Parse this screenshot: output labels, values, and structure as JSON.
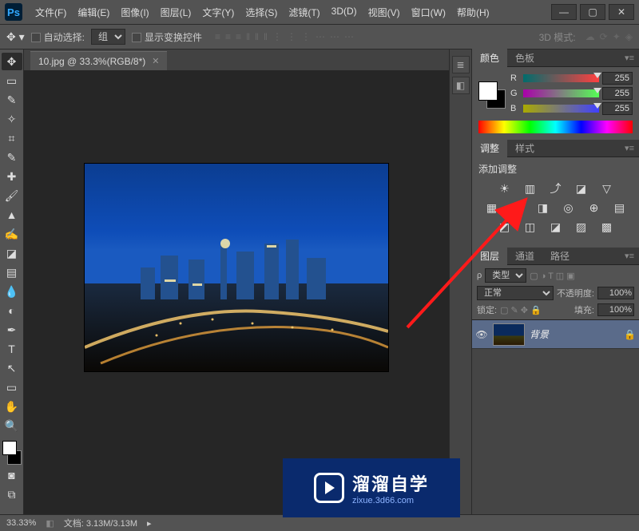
{
  "app": {
    "logo": "Ps"
  },
  "menu": [
    "文件(F)",
    "编辑(E)",
    "图像(I)",
    "图层(L)",
    "文字(Y)",
    "选择(S)",
    "滤镜(T)",
    "3D(D)",
    "视图(V)",
    "窗口(W)",
    "帮助(H)"
  ],
  "options": {
    "auto_select": "自动选择:",
    "group": "组",
    "show_transform": "显示变换控件",
    "mode3d": "3D 模式:"
  },
  "doc": {
    "tab_title": "10.jpg @ 33.3%(RGB/8*)"
  },
  "panels": {
    "color_tabs": [
      "颜色",
      "色板"
    ],
    "adjust_tabs": [
      "调整",
      "样式"
    ],
    "layer_tabs": [
      "图层",
      "通道",
      "路径"
    ]
  },
  "color": {
    "r_label": "R",
    "g_label": "G",
    "b_label": "B",
    "r": "255",
    "g": "255",
    "b": "255"
  },
  "adjust": {
    "title": "添加调整"
  },
  "layers": {
    "kind_label": "类型",
    "blend": "正常",
    "opacity_label": "不透明度:",
    "opacity": "100%",
    "lock_label": "锁定:",
    "fill_label": "填充:",
    "fill": "100%",
    "layer_name": "背景"
  },
  "status": {
    "zoom": "33.33%",
    "doc": "文档: 3.13M/3.13M"
  },
  "watermark": {
    "big": "溜溜自学",
    "small": "zixue.3d66.com"
  }
}
